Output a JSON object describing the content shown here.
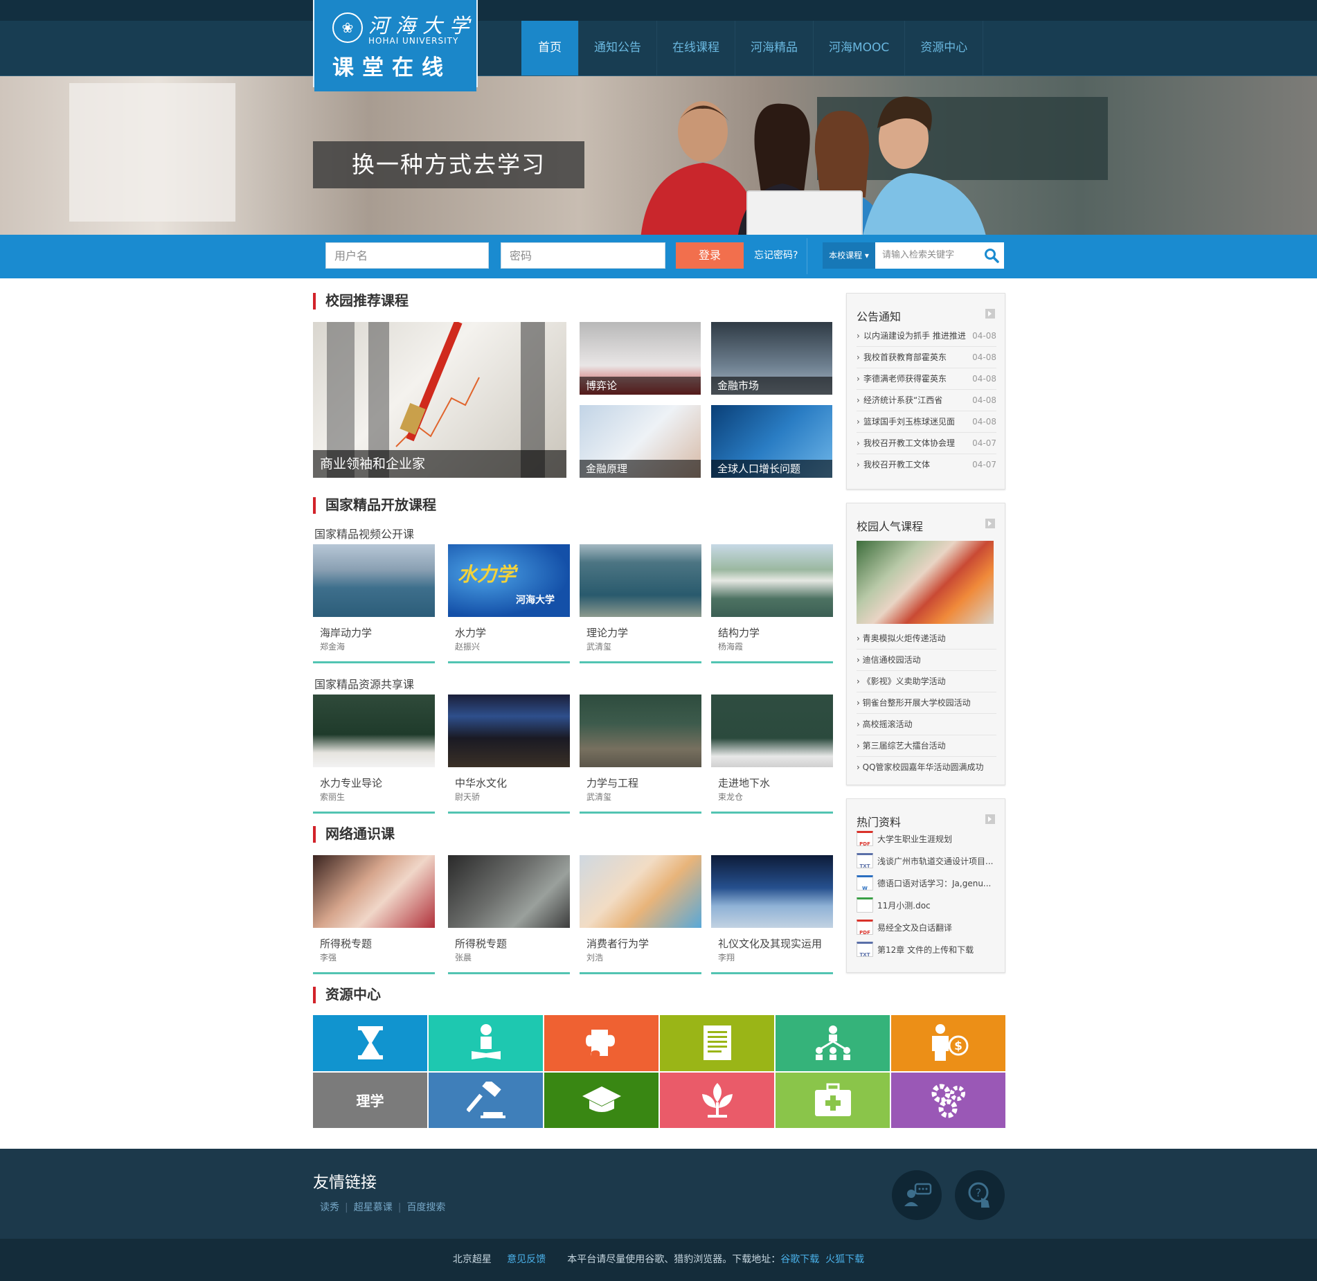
{
  "header": {
    "logo": {
      "brand_cn": "河海大学",
      "brand_en": "HOHAI UNIVERSITY",
      "site_name": "课堂在线"
    },
    "nav": [
      {
        "label": "首页",
        "active": true
      },
      {
        "label": "通知公告",
        "active": false
      },
      {
        "label": "在线课程",
        "active": false
      },
      {
        "label": "河海精品",
        "active": false
      },
      {
        "label": "河海MOOC",
        "active": false
      },
      {
        "label": "资源中心",
        "active": false
      }
    ]
  },
  "hero": {
    "slogan": "换一种方式去学习"
  },
  "login": {
    "username_placeholder": "用户名",
    "password_placeholder": "密码",
    "login_label": "登录",
    "forgot_label": "忘记密码?",
    "search_scope": "本校课程",
    "search_placeholder": "请输入检索关键字"
  },
  "recommended": {
    "title": "校园推荐课程",
    "featured": "商业领袖和企业家",
    "tiles": [
      "博弈论",
      "金融市场",
      "金融原理",
      "全球人口增长问题"
    ]
  },
  "national": {
    "title": "国家精品开放课程",
    "video_subtitle": "国家精品视频公开课",
    "video_courses": [
      {
        "name": "海岸动力学",
        "teacher": "郑金海"
      },
      {
        "name": "水力学",
        "teacher": "赵振兴"
      },
      {
        "name": "理论力学",
        "teacher": "武清玺"
      },
      {
        "name": "结构力学",
        "teacher": "杨海霞"
      }
    ],
    "resource_subtitle": "国家精品资源共享课",
    "resource_courses": [
      {
        "name": "水力专业导论",
        "teacher": "索丽生"
      },
      {
        "name": "中华水文化",
        "teacher": "尉天骄"
      },
      {
        "name": "力学与工程",
        "teacher": "武清玺"
      },
      {
        "name": "走进地下水",
        "teacher": "束龙仓"
      }
    ],
    "shuili_thumb_text": "水力学",
    "hohai_thumb_text": "河海大学"
  },
  "general": {
    "title": "网络通识课",
    "courses": [
      {
        "name": "所得税专题",
        "teacher": "李强"
      },
      {
        "name": "所得税专题",
        "teacher": "张晨"
      },
      {
        "name": "消费者行为学",
        "teacher": "刘浩"
      },
      {
        "name": "礼仪文化及其现实运用",
        "teacher": "李翔"
      }
    ]
  },
  "resources": {
    "title": "资源中心",
    "cells": [
      {
        "icon": "hourglass-icon",
        "color": "#1194cf",
        "label": ""
      },
      {
        "icon": "meditation-icon",
        "color": "#1ec8b0",
        "label": ""
      },
      {
        "icon": "puzzle-icon",
        "color": "#ef6132",
        "label": ""
      },
      {
        "icon": "document-icon",
        "color": "#9ab517",
        "label": ""
      },
      {
        "icon": "network-icon",
        "color": "#35b37a",
        "label": ""
      },
      {
        "icon": "businessman-dollar-icon",
        "color": "#ec8f17",
        "label": ""
      },
      {
        "icon": "",
        "color": "#7b7b7b",
        "label": "理学"
      },
      {
        "icon": "gavel-icon",
        "color": "#3f7fba",
        "label": ""
      },
      {
        "icon": "graduation-cap-icon",
        "color": "#398713",
        "label": ""
      },
      {
        "icon": "plant-icon",
        "color": "#ea5b69",
        "label": ""
      },
      {
        "icon": "medical-kit-icon",
        "color": "#8ac54a",
        "label": ""
      },
      {
        "icon": "gears-icon",
        "color": "#9a58b6",
        "label": ""
      }
    ]
  },
  "sidebar": {
    "notices": {
      "title": "公告通知",
      "items": [
        {
          "text": "以内涵建设为抓手 推进推进",
          "date": "04-08"
        },
        {
          "text": "我校首获教育部霍英东",
          "date": "04-08"
        },
        {
          "text": "李德满老师获得霍英东",
          "date": "04-08"
        },
        {
          "text": "经济统计系获“江西省",
          "date": "04-08"
        },
        {
          "text": "篮球国手刘玉栋球迷见面",
          "date": "04-08"
        },
        {
          "text": "我校召开教工文体协会理",
          "date": "04-07"
        },
        {
          "text": "我校召开教工文体",
          "date": "04-07"
        }
      ]
    },
    "popular": {
      "title": "校园人气课程",
      "items": [
        "青奥模拟火炬传递活动",
        "迪信通校园活动",
        "《影视》义卖助学活动",
        "铜雀台整形开展大学校园活动",
        "高校摇滚活动",
        "第三届综艺大擂台活动",
        "QQ管家校园嘉年华活动圆满成功"
      ]
    },
    "hot_docs": {
      "title": "热门资料",
      "items": [
        {
          "type": "PDF",
          "color": "#d9322a",
          "text": "大学生职业生涯规划"
        },
        {
          "type": "TXT",
          "color": "#5a6fa8",
          "text": "浅谈广州市轨道交通设计项目..."
        },
        {
          "type": "W",
          "color": "#2b6fc1",
          "text": "德语口语对话学习：Ja,genu..."
        },
        {
          "type": "",
          "color": "#3aa046",
          "text": "11月小测.doc"
        },
        {
          "type": "PDF",
          "color": "#d9322a",
          "text": "易经全文及白话翻译"
        },
        {
          "type": "TXT",
          "color": "#5a6fa8",
          "text": "第12章 文件的上传和下载"
        }
      ]
    }
  },
  "footer": {
    "friend_title": "友情链接",
    "links": [
      "读秀",
      "超星慕课",
      "百度搜索"
    ],
    "bottom": {
      "org": "北京超星",
      "feedback": "意见反馈",
      "notice": "本平台请尽量使用谷歌、猎豹浏览器。下载地址：",
      "chrome": "谷歌下载",
      "firefox": "火狐下载"
    }
  }
}
